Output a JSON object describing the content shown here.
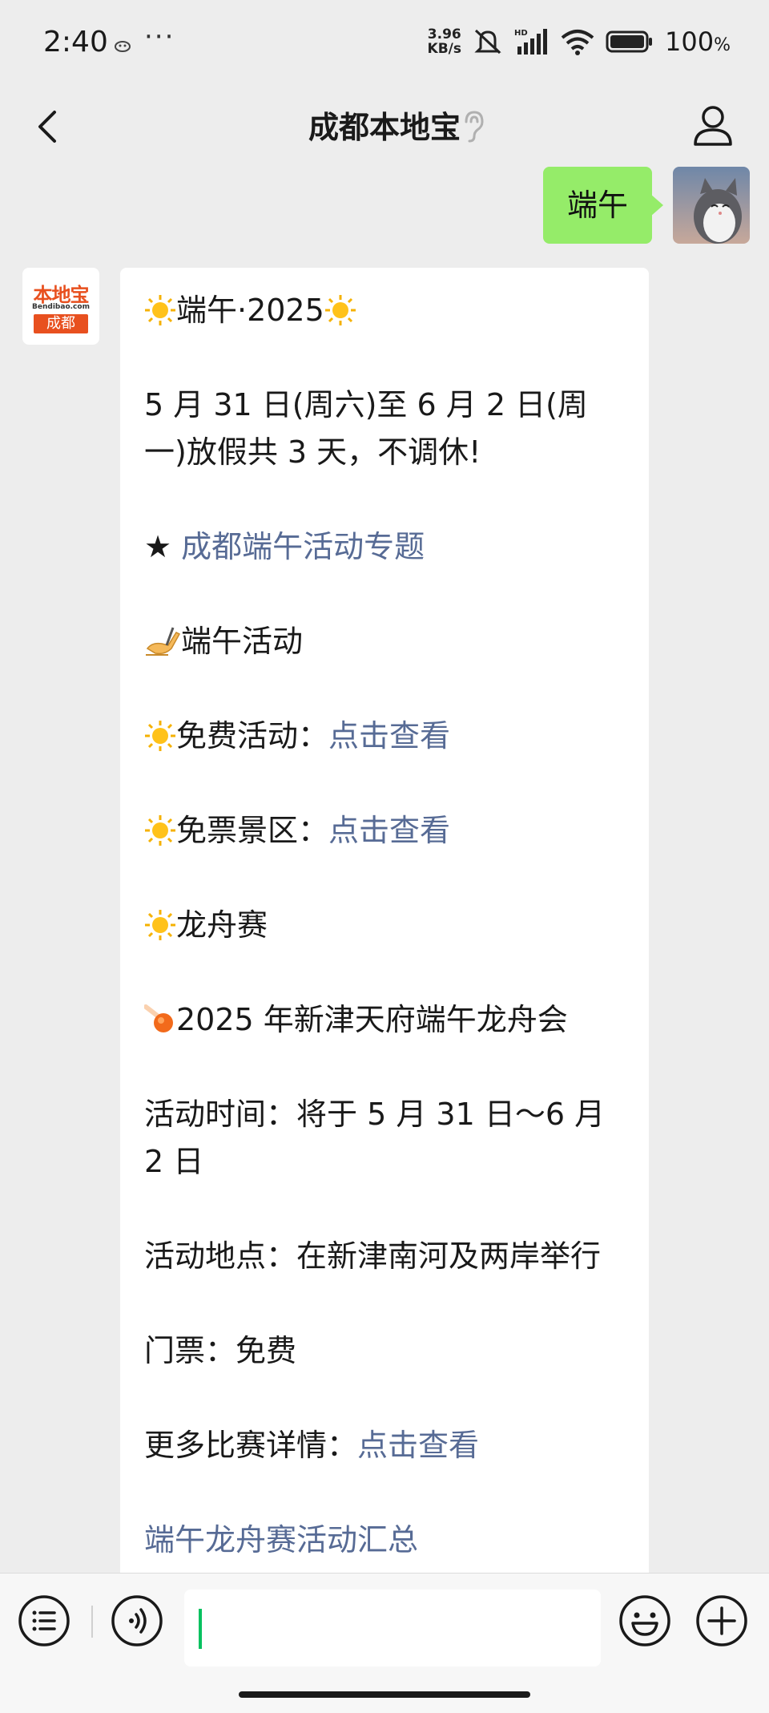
{
  "status_bar": {
    "time": "2:40",
    "more": "···",
    "net_speed_value": "3.96",
    "net_speed_unit": "KB/s",
    "battery": "100",
    "battery_unit": "%"
  },
  "nav": {
    "title": "成都本地宝"
  },
  "my_message": {
    "text": "端午"
  },
  "sender_logo": {
    "name": "本地宝",
    "domain": "Bendibao.com",
    "city": "成都"
  },
  "reply": {
    "title_text": "端午·2025",
    "holiday_line": "5 月 31 日(周六)至 6 月 2 日(周一)放假共 3 天，不调休!",
    "topic_star": "★ ",
    "topic_link": "成都端午活动专题",
    "activities_heading": "端午活动",
    "free_label": "免费活动：",
    "free_link": "点击查看",
    "ticket_label": "免票景区：",
    "ticket_link": "点击查看",
    "dragon_heading": "龙舟赛",
    "event_title": "2025 年新津天府端午龙舟会",
    "event_time": "活动时间：将于 5 月 31 日～6 月 2 日",
    "event_place": "活动地点：在新津南河及两岸举行",
    "event_ticket": "门票：免费",
    "more_label": "更多比赛详情：",
    "more_link": "点击查看",
    "summary_link": "端午龙舟赛活动汇总"
  },
  "colors": {
    "background": "#ededed",
    "my_bubble": "#95ec69",
    "link": "#576b95",
    "cursor": "#07c160",
    "brand": "#e8501f"
  }
}
